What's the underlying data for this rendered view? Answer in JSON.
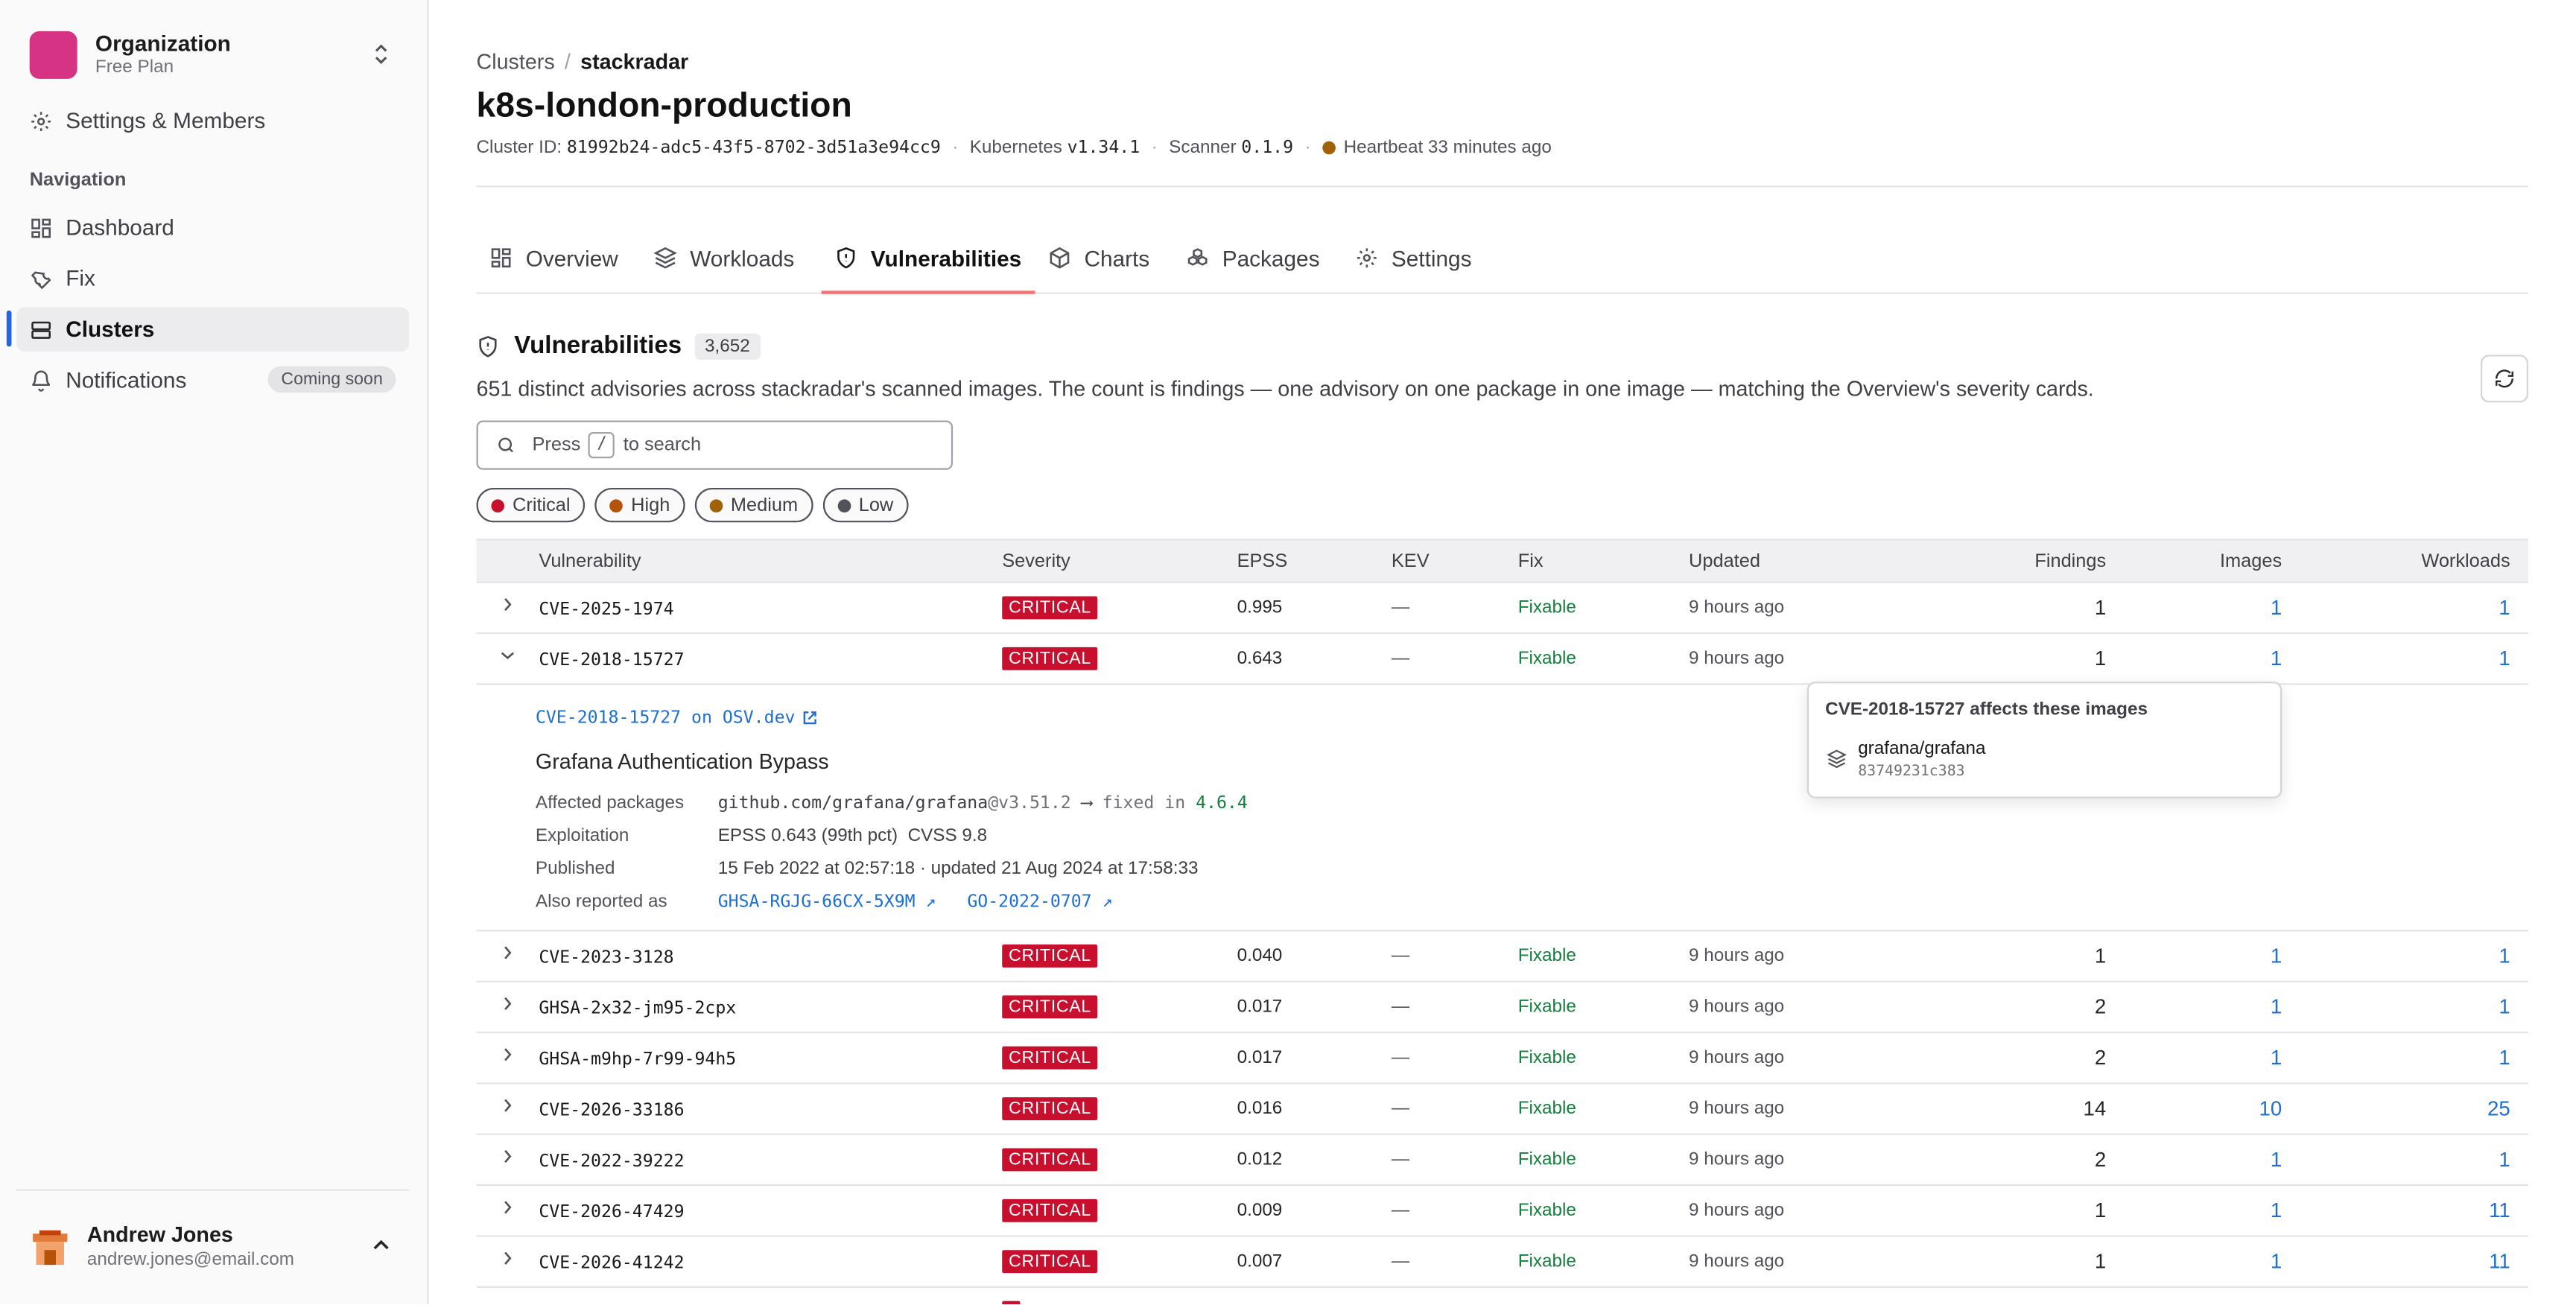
{
  "org": {
    "name": "Organization",
    "plan": "Free Plan"
  },
  "sidebar": {
    "settings_label": "Settings & Members",
    "nav_title": "Navigation",
    "items": [
      {
        "label": "Dashboard",
        "icon": "dashboard-icon"
      },
      {
        "label": "Fix",
        "icon": "wrench-icon"
      },
      {
        "label": "Clusters",
        "icon": "server-icon",
        "active": true
      },
      {
        "label": "Notifications",
        "icon": "bell-icon",
        "badge": "Coming soon"
      }
    ]
  },
  "user": {
    "name": "Andrew Jones",
    "email": "andrew.jones@email.com"
  },
  "breadcrumb": {
    "parent": "Clusters",
    "sep": "/",
    "current": "stackradar"
  },
  "page_title": "k8s-london-production",
  "meta": {
    "cluster_label": "Cluster ID:",
    "cluster_id": "81992b24-adc5-43f5-8702-3d51a3e94cc9",
    "dot": "·",
    "k8s_label": "Kubernetes",
    "k8s_version": "v1.34.1",
    "scanner_label": "Scanner",
    "scanner_version": "0.1.9",
    "heartbeat": "Heartbeat 33 minutes ago",
    "heartbeat_color": "#a16207"
  },
  "tabs": [
    {
      "label": "Overview"
    },
    {
      "label": "Workloads"
    },
    {
      "label": "Vulnerabilities",
      "active": true
    },
    {
      "label": "Charts"
    },
    {
      "label": "Packages"
    },
    {
      "label": "Settings"
    }
  ],
  "section": {
    "title": "Vulnerabilities",
    "count": "3,652",
    "description": "651 distinct advisories across stackradar's scanned images. The count is findings — one advisory on one package in one image — matching the Overview's severity cards."
  },
  "search": {
    "prefix": "Press",
    "key": "/",
    "suffix": "to search"
  },
  "filters": [
    {
      "label": "Critical",
      "color": "#c8102e"
    },
    {
      "label": "High",
      "color": "#b45309"
    },
    {
      "label": "Medium",
      "color": "#a16207"
    },
    {
      "label": "Low",
      "color": "#52525b"
    }
  ],
  "table": {
    "headers": {
      "vulnerability": "Vulnerability",
      "severity": "Severity",
      "epss": "EPSS",
      "kev": "KEV",
      "fix": "Fix",
      "updated": "Updated",
      "findings": "Findings",
      "images": "Images",
      "workloads": "Workloads"
    },
    "rows": [
      {
        "id": "CVE-2025-1974",
        "severity": "CRITICAL",
        "epss": "0.995",
        "kev": "—",
        "fix": "Fixable",
        "updated": "9 hours ago",
        "findings": "1",
        "images": "1",
        "workloads": "1"
      },
      {
        "id": "CVE-2018-15727",
        "severity": "CRITICAL",
        "epss": "0.643",
        "kev": "—",
        "fix": "Fixable",
        "updated": "9 hours ago",
        "findings": "1",
        "images": "1",
        "workloads": "1",
        "expanded": true
      },
      {
        "id": "CVE-2023-3128",
        "severity": "CRITICAL",
        "epss": "0.040",
        "kev": "—",
        "fix": "Fixable",
        "updated": "9 hours ago",
        "findings": "1",
        "images": "1",
        "workloads": "1"
      },
      {
        "id": "GHSA-2x32-jm95-2cpx",
        "severity": "CRITICAL",
        "epss": "0.017",
        "kev": "—",
        "fix": "Fixable",
        "updated": "9 hours ago",
        "findings": "2",
        "images": "1",
        "workloads": "1"
      },
      {
        "id": "GHSA-m9hp-7r99-94h5",
        "severity": "CRITICAL",
        "epss": "0.017",
        "kev": "—",
        "fix": "Fixable",
        "updated": "9 hours ago",
        "findings": "2",
        "images": "1",
        "workloads": "1"
      },
      {
        "id": "CVE-2026-33186",
        "severity": "CRITICAL",
        "epss": "0.016",
        "kev": "—",
        "fix": "Fixable",
        "updated": "9 hours ago",
        "findings": "14",
        "images": "10",
        "workloads": "25"
      },
      {
        "id": "CVE-2022-39222",
        "severity": "CRITICAL",
        "epss": "0.012",
        "kev": "—",
        "fix": "Fixable",
        "updated": "9 hours ago",
        "findings": "2",
        "images": "1",
        "workloads": "1"
      },
      {
        "id": "CVE-2026-47429",
        "severity": "CRITICAL",
        "epss": "0.009",
        "kev": "—",
        "fix": "Fixable",
        "updated": "9 hours ago",
        "findings": "1",
        "images": "1",
        "workloads": "11"
      },
      {
        "id": "CVE-2026-41242",
        "severity": "CRITICAL",
        "epss": "0.007",
        "kev": "—",
        "fix": "Fixable",
        "updated": "9 hours ago",
        "findings": "1",
        "images": "1",
        "workloads": "11"
      }
    ]
  },
  "detail": {
    "osv_link": "CVE-2018-15727 on OSV.dev",
    "title": "Grafana Authentication Bypass",
    "affected_label": "Affected packages",
    "affected_pkg": "github.com/grafana/grafana",
    "affected_ver": "@v3.51.2",
    "arrow": "⟶",
    "fixed_in_label": "fixed in",
    "fixed_in": "4.6.4",
    "exploitation_label": "Exploitation",
    "exploitation": "EPSS 0.643 (99th pct)  CVSS 9.8",
    "published_label": "Published",
    "published": "15 Feb 2022 at 02:57:18 · updated 21 Aug 2024 at 17:58:33",
    "also_label": "Also reported as",
    "also": [
      "GHSA-RGJG-66CX-5X9M ↗",
      "GO-2022-0707 ↗"
    ]
  },
  "popover": {
    "title": "CVE-2018-15727 affects these images",
    "image_name": "grafana/grafana",
    "image_hash": "83749231c383"
  }
}
